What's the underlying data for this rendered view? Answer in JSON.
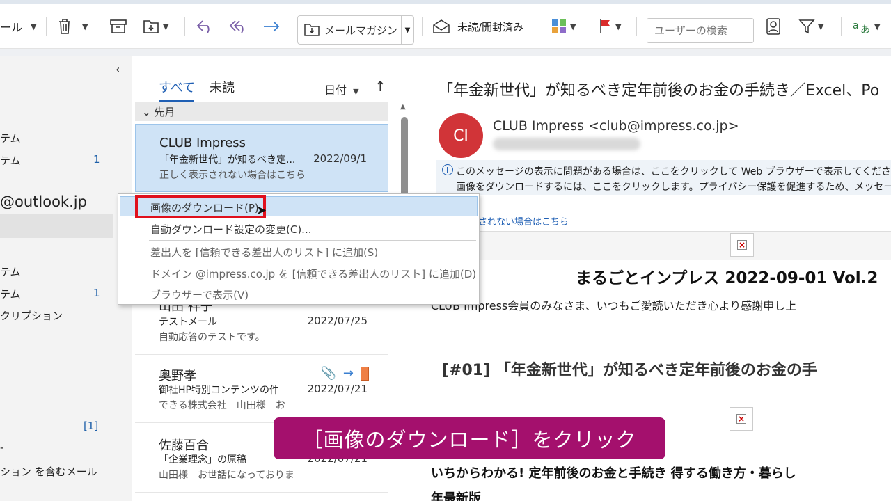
{
  "toolbar": {
    "move_label_partial": "ール",
    "move_folder_label": "メールマガジン",
    "unread_read_label": "未読/開封済み",
    "search_placeholder": "ユーザーの検索"
  },
  "folders": {
    "items": [
      {
        "label": "テム",
        "count": ""
      },
      {
        "label": "テム",
        "count": "1"
      }
    ],
    "account": "@outlook.jp",
    "items2": [
      {
        "label": "テム",
        "count": ""
      },
      {
        "label": "テム",
        "count": "1"
      },
      {
        "label": "クリプション",
        "count": ""
      }
    ],
    "bracket_count": "[1]",
    "dash": "-",
    "search_folder": "ション を含むメール"
  },
  "list": {
    "tabs": [
      "すべて",
      "未読"
    ],
    "sort_label": "日付",
    "sort_arrow": "↑",
    "group": "先月",
    "messages": [
      {
        "sender": "CLUB Impress",
        "subject": "「年金新世代」が知るべき定...",
        "date": "2022/09/1",
        "preview": "正しく表示されない場合はこちら"
      },
      {
        "sender": "山田 祥子",
        "subject": "テストメール",
        "date": "2022/07/25",
        "preview": "自動応答のテストです。"
      },
      {
        "sender": "奥野孝",
        "subject": "御社HP特別コンテンツの件",
        "date": "2022/07/21",
        "preview": "できる株式会社　山田様　お"
      },
      {
        "sender": "佐藤百合",
        "subject": "「企業理念」の原稿",
        "date": "2022/07/21",
        "preview": "山田様　お世話になっておりま"
      }
    ]
  },
  "context_menu": {
    "items": [
      "画像のダウンロード(P)",
      "自動ダウンロード設定の変更(C)...",
      "差出人を [信頼できる差出人のリスト] に追加(S)",
      "ドメイン @impress.co.jp を [信頼できる差出人のリスト] に追加(D)",
      "ブラウザーで表示(V)"
    ]
  },
  "reading": {
    "title": "「年金新世代」が知るべき定年前後のお金の手続き／Excel、Po",
    "avatar_initials": "CI",
    "from": "CLUB Impress <club@impress.co.jp>",
    "info_line1": "このメッセージの表示に問題がある場合は、ここをクリックして Web ブラウザーで表示してください。",
    "info_line2": "画像をダウンロードするには、ここをクリックします。プライバシー保護を促進するため、メッセージ内の画像",
    "link_text": "されない場合はこちら",
    "nl_header": "まるごとインプレス 2022-09-01 Vol.2",
    "nl_greeting": "CLUB Impress会員のみなさま、いつもご愛読いただき心より感謝申し上",
    "nl_heading": "[#01] 「年金新世代」が知るべき定年前後のお金の手",
    "nl_bold1": "いちからわかる! 定年前後のお金と手続き 得する働き方・暮らし",
    "nl_bold2": "年最新版"
  },
  "caption": "［画像のダウンロード］をクリック",
  "colors": {
    "accent": "#1f5fb4",
    "avatar": "#d13438",
    "caption_bg": "#a4106d",
    "highlight_box": "#e0101c"
  }
}
